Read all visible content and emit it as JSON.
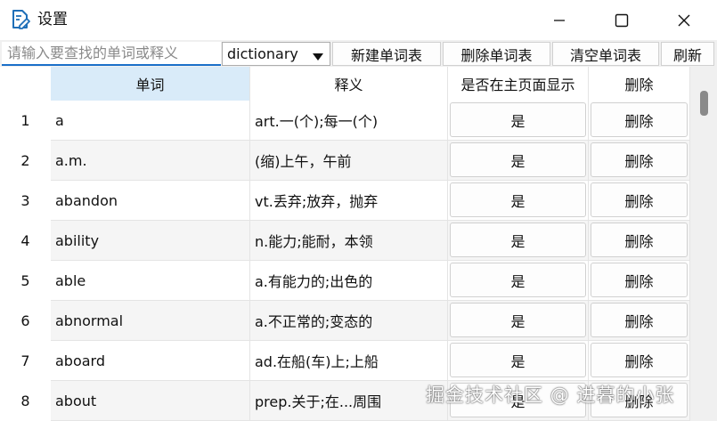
{
  "window": {
    "title": "设置",
    "icons": {
      "app": "notepad-edit-icon",
      "minimize": "minimize-icon",
      "maximize": "maximize-icon",
      "close": "close-icon"
    }
  },
  "toolbar": {
    "search_placeholder": "请输入要查找的单词或释义",
    "search_value": "",
    "dictionary_selected": "dictionary",
    "new_label": "新建单词表",
    "delete_label": "删除单词表",
    "clear_label": "清空单词表",
    "refresh_label": "刷新"
  },
  "table": {
    "columns": [
      "单词",
      "释义",
      "是否在主页面显示",
      "删除"
    ],
    "selected_column": 0,
    "rows": [
      {
        "num": "1",
        "word": "a",
        "definition": "art.一(个);每一(个)",
        "show": "是",
        "action": "删除"
      },
      {
        "num": "2",
        "word": "a.m.",
        "definition": "(缩)上午，午前",
        "show": "是",
        "action": "删除"
      },
      {
        "num": "3",
        "word": "abandon",
        "definition": "vt.丢弃;放弃，抛弃",
        "show": "是",
        "action": "删除"
      },
      {
        "num": "4",
        "word": "ability",
        "definition": "n.能力;能耐，本领",
        "show": "是",
        "action": "删除"
      },
      {
        "num": "5",
        "word": "able",
        "definition": "a.有能力的;出色的",
        "show": "是",
        "action": "删除"
      },
      {
        "num": "6",
        "word": "abnormal",
        "definition": "a.不正常的;变态的",
        "show": "是",
        "action": "删除"
      },
      {
        "num": "7",
        "word": "aboard",
        "definition": "ad.在船(车)上;上船",
        "show": "是",
        "action": "删除"
      },
      {
        "num": "8",
        "word": "about",
        "definition": "prep.关于;在...周围",
        "show": "是",
        "action": "删除"
      }
    ]
  },
  "watermark": "掘金技术社区 @ 进暮的小张",
  "colors": {
    "accent": "#1a6fc9",
    "header_selected": "#d9ebf9",
    "row_alt": "#f5f5f5",
    "chrome": "#f0f0f0"
  }
}
